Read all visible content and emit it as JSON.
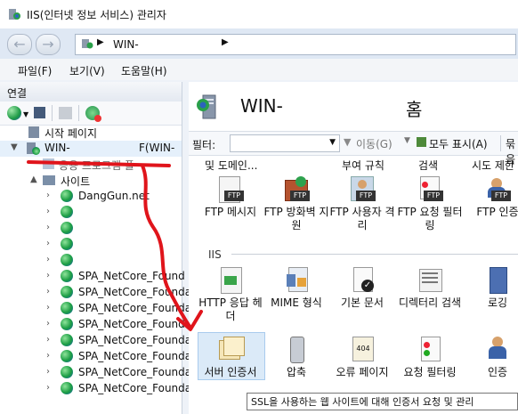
{
  "window": {
    "title": "IIS(인터넷 정보 서비스) 관리자"
  },
  "address": {
    "path_item": "WIN-"
  },
  "menu": [
    "파일(F)",
    "보기(V)",
    "도움말(H)"
  ],
  "left_panel": {
    "title": "연결",
    "tree": {
      "start_page": "시작 페이지",
      "server": "WIN-",
      "server_suffix": "F(WIN-",
      "app_pools": "응용 프로그램 풀",
      "sites": "사이트",
      "site_items": [
        "DangGun.net",
        "",
        "",
        "",
        "",
        "SPA_NetCore_Found",
        "SPA_NetCore_Founda",
        "SPA_NetCore_Founda",
        "SPA_NetCore_Founda",
        "SPA_NetCore_Founda",
        "SPA_NetCore_Founda",
        "SPA_NetCore_Founda",
        "SPA_NetCore_Founda"
      ]
    }
  },
  "right_panel": {
    "title_left": "WIN-",
    "title_right": "홈",
    "filter": {
      "label": "필터:",
      "go_label": "이동(G)",
      "show_all": "모두 표시(A)",
      "group": "묶음"
    },
    "top_row_labels": [
      "및 도메인...",
      "부여 규칙",
      "검색",
      "시도 제한"
    ],
    "ftp_features": [
      {
        "label": "FTP 메시지",
        "icon": "ftp-message-icon"
      },
      {
        "label": "FTP 방화벽 지원",
        "icon": "ftp-firewall-icon"
      },
      {
        "label": "FTP 사용자 격리",
        "icon": "ftp-user-isolation-icon"
      },
      {
        "label": "FTP 요청 필터링",
        "icon": "ftp-request-filtering-icon"
      },
      {
        "label": "FTP 인증",
        "icon": "ftp-authentication-icon"
      }
    ],
    "iis_section": "IIS",
    "iis_features": [
      {
        "label": "HTTP 응답 헤더",
        "icon": "http-response-headers-icon"
      },
      {
        "label": "MIME 형식",
        "icon": "mime-types-icon"
      },
      {
        "label": "기본 문서",
        "icon": "default-document-icon"
      },
      {
        "label": "디렉터리 검색",
        "icon": "directory-browsing-icon"
      },
      {
        "label": "로깅",
        "icon": "logging-icon"
      }
    ],
    "iis_features_row2": [
      {
        "label": "서버 인증서",
        "icon": "server-certificates-icon"
      },
      {
        "label": "압축",
        "icon": "compression-icon"
      },
      {
        "label": "오류 페이지",
        "icon": "error-pages-icon"
      },
      {
        "label": "요청 필터링",
        "icon": "request-filtering-icon"
      },
      {
        "label": "인증",
        "icon": "authentication-icon"
      }
    ],
    "tooltip": "SSL을 사용하는 웹 사이트에 대해 인증서 요청 및 관리"
  },
  "colors": {
    "annotation": "#e0141b",
    "selection": "#cce4f7"
  }
}
